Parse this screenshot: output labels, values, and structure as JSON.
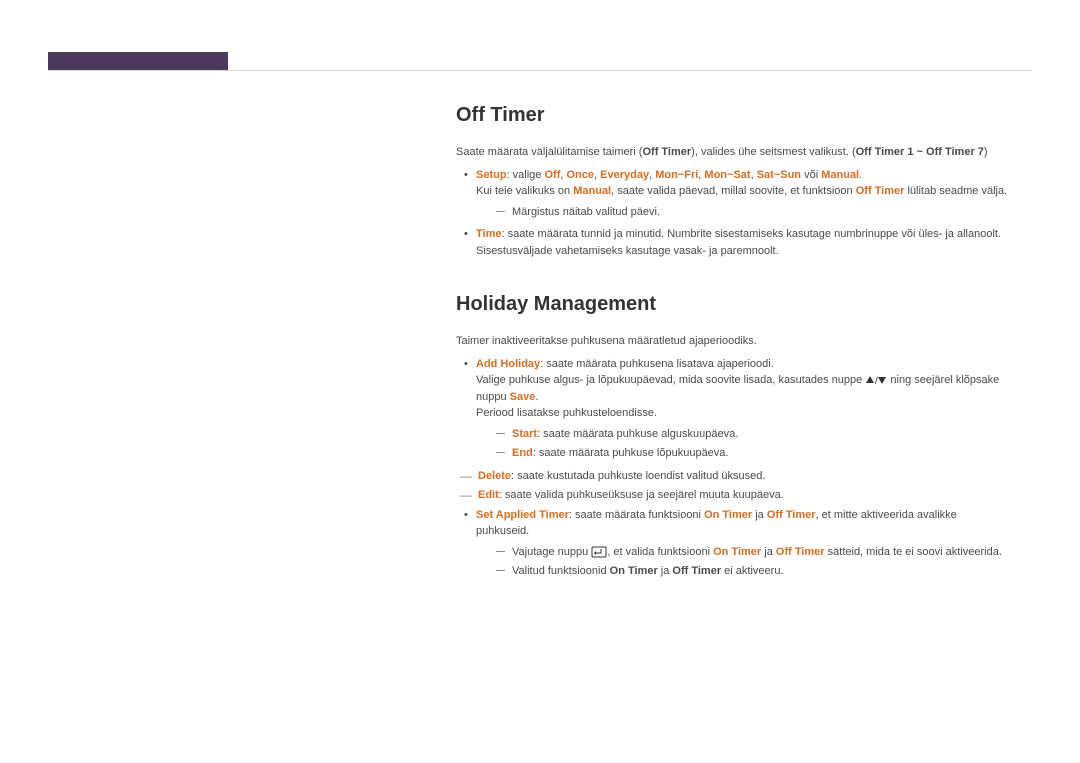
{
  "sections": {
    "off_timer": {
      "heading": "Off Timer",
      "intro_pre": "Saate määrata väljalülitamise taimeri (",
      "intro_ot": "Off Timer",
      "intro_mid": "), valides ühe seitsmest valikust. (",
      "intro_range": "Off Timer 1 ~ Off Timer 7",
      "intro_end": ")",
      "setup_label": "Setup",
      "setup_mid": ": valige ",
      "setup_off": "Off",
      "setup_once": "Once",
      "setup_everyday": "Everyday",
      "setup_monfri": "Mon~Fri",
      "setup_monsat": "Mon~Sat",
      "setup_satsun": "Sat~Sun",
      "setup_voi": " või ",
      "setup_manual": "Manual",
      "setup_dot": ".",
      "setup_line2a": "Kui teie valikuks on ",
      "setup_line2b": ", saate valida päevad, millal soovite, et funktsioon ",
      "setup_line2c": " lülitab seadme välja.",
      "setup_sub": "Märgistus näitab valitud päevi.",
      "time_label": "Time",
      "time_text": ": saate määrata tunnid ja minutid. Numbrite sisestamiseks kasutage numbrinuppe või üles- ja allanoolt. Sisestusväljade vahetamiseks kasutage vasak- ja paremnoolt."
    },
    "holiday": {
      "heading": "Holiday Management",
      "intro": "Taimer inaktiveeritakse puhkusena määratletud ajaperioodiks.",
      "add_label": "Add Holiday",
      "add_text": ": saate määrata puhkusena lisatava ajaperioodi.",
      "add_line2a": "Valige puhkuse algus- ja lõpukuupäevad, mida soovite lisada, kasutades nuppe ",
      "add_line2b": " ning seejärel klõpsake nuppu ",
      "add_save": "Save",
      "add_line2c": ".",
      "add_line3": "Periood lisatakse puhkusteloendisse.",
      "start_label": "Start",
      "start_text": ": saate määrata puhkuse alguskuupäeva.",
      "end_label": "End",
      "end_text": ": saate määrata puhkuse lõpukuupäeva.",
      "delete_label": "Delete",
      "delete_text": ": saate kustutada puhkuste loendist valitud üksused.",
      "edit_label": "Edit",
      "edit_text": ": saate valida puhkuseüksuse ja seejärel muuta kuupäeva.",
      "sat_label": "Set Applied Timer",
      "sat_text_a": ": saate määrata funktsiooni ",
      "sat_on": "On Timer",
      "sat_text_b": " ja ",
      "sat_off": "Off Timer",
      "sat_text_c": ", et mitte aktiveerida avalikke puhkuseid.",
      "sat_sub1a": "Vajutage nuppu ",
      "sat_sub1b": ", et valida funktsiooni ",
      "sat_sub1c": " sätteid, mida te ei soovi aktiveerida.",
      "sat_sub2a": "Valitud funktsioonid ",
      "sat_sub2c": " ei aktiveeru."
    }
  }
}
